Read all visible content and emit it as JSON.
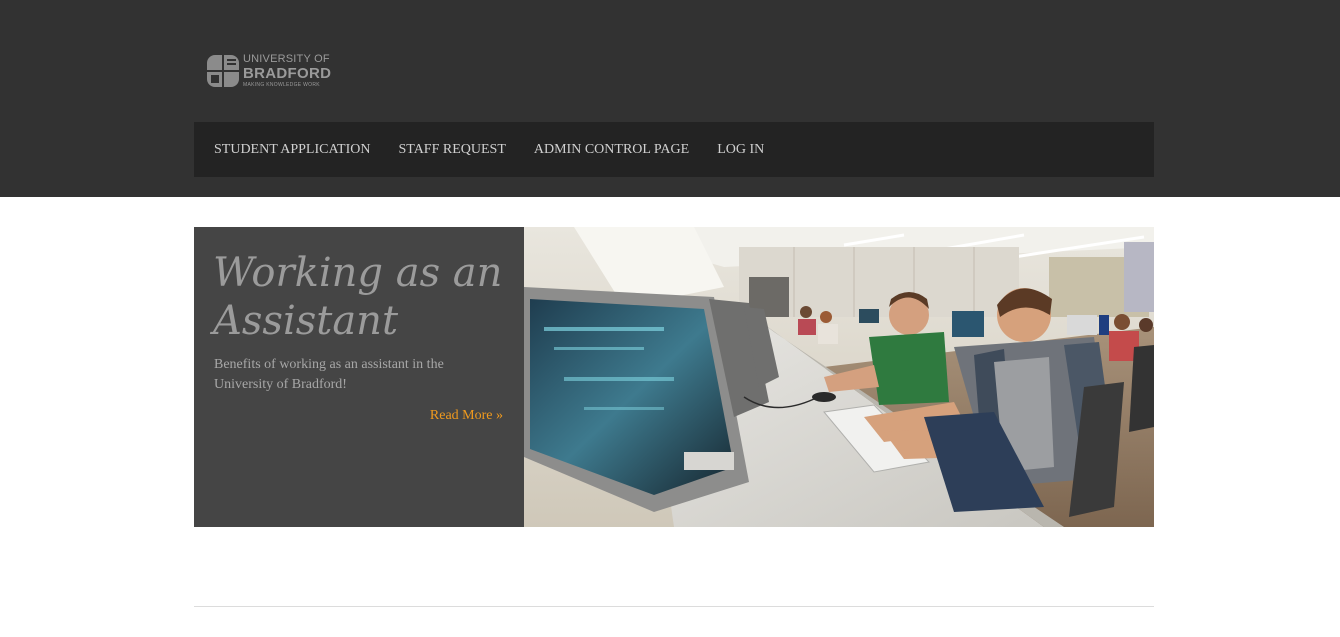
{
  "logo": {
    "line1": "UNIVERSITY OF",
    "line2": "BRADFORD",
    "line3": "MAKING KNOWLEDGE WORK"
  },
  "nav": {
    "items": [
      {
        "label": "STUDENT APPLICATION"
      },
      {
        "label": "STAFF REQUEST"
      },
      {
        "label": "ADMIN CONTROL PAGE"
      },
      {
        "label": "LOG IN"
      }
    ]
  },
  "slide": {
    "title": "Working as an Assistant",
    "description": "Benefits of working as an assistant in the University of Bradford!",
    "read_more": "Read More »",
    "image_subject": "students-at-computer-lab"
  },
  "colors": {
    "header_bg": "#323232",
    "nav_bg": "#232323",
    "slide_panel_bg": "#454545",
    "accent_link": "#f09a1e"
  }
}
